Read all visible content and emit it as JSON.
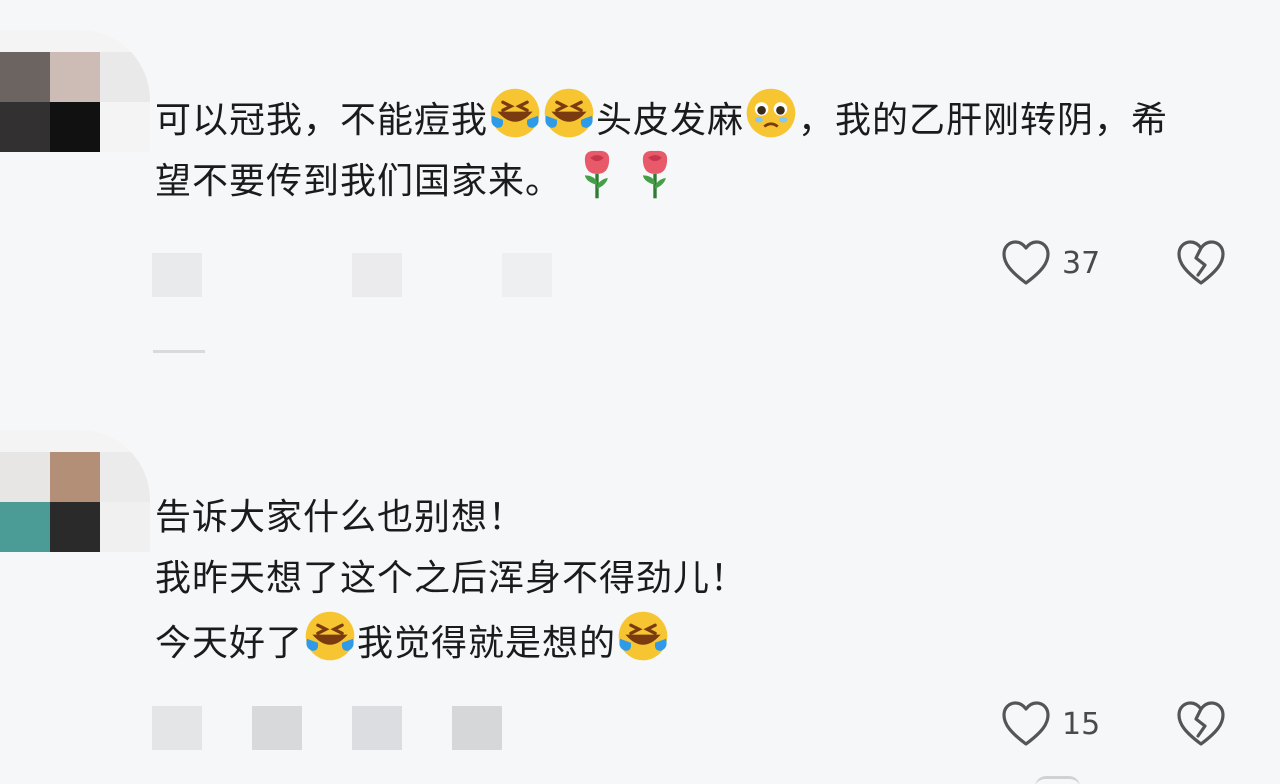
{
  "comments": [
    {
      "lines": [
        [
          "可以冠我，不能痘我",
          "emoji:laughing-crying",
          "emoji:laughing-crying",
          "头皮发麻",
          "emoji:pleading",
          "，我的乙肝刚转阴，希"
        ],
        [
          "望不要传到我们国家来。",
          "emoji:rose",
          "emoji:rose"
        ]
      ],
      "like_count": "37",
      "like_icon": "heart-outline-icon",
      "dislike_icon": "broken-heart-icon"
    },
    {
      "lines": [
        [
          "告诉大家什么也别想！"
        ],
        [
          "我昨天想了这个之后浑身不得劲儿！"
        ],
        [
          "今天好了",
          "emoji:laughing-crying",
          "我觉得就是想的",
          "emoji:laughing-crying"
        ]
      ],
      "like_count": "15",
      "like_icon": "heart-outline-icon",
      "dislike_icon": "broken-heart-icon"
    }
  ],
  "colors": {
    "background": "#f6f7f9",
    "text": "#1b1b1b",
    "icon": "#555555",
    "emoji_yellow": "#f7c531",
    "emoji_tear": "#2f9be8",
    "rose": "#e8596a"
  }
}
